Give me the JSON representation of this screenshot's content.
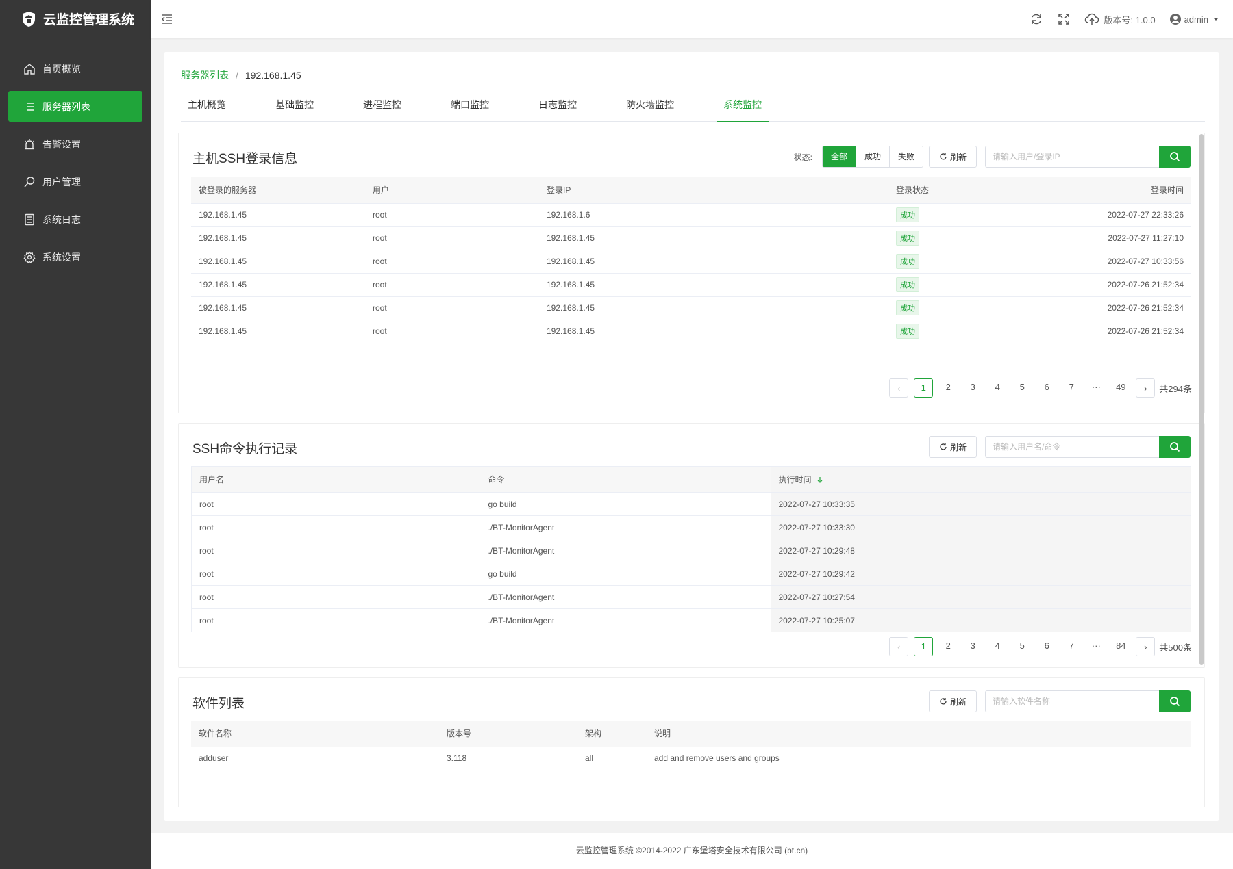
{
  "app": {
    "title": "云监控管理系统"
  },
  "sidebar": {
    "items": [
      {
        "label": "首页概览",
        "icon": "home-icon"
      },
      {
        "label": "服务器列表",
        "icon": "list-icon",
        "active": true
      },
      {
        "label": "告警设置",
        "icon": "alarm-icon"
      },
      {
        "label": "用户管理",
        "icon": "user-search-icon"
      },
      {
        "label": "系统日志",
        "icon": "log-icon"
      },
      {
        "label": "系统设置",
        "icon": "gear-icon"
      }
    ]
  },
  "header": {
    "version_label": "版本号: 1.0.0",
    "user": "admin"
  },
  "breadcrumb": {
    "parent": "服务器列表",
    "separator": "/",
    "current": "192.168.1.45"
  },
  "tabs": [
    "主机概览",
    "基础监控",
    "进程监控",
    "端口监控",
    "日志监控",
    "防火墙监控",
    "系统监控"
  ],
  "active_tab": "系统监控",
  "ssh_login": {
    "title": "主机SSH登录信息",
    "status_label": "状态:",
    "filters": [
      "全部",
      "成功",
      "失败"
    ],
    "refresh": "刷新",
    "search_placeholder": "请输入用户/登录IP",
    "columns": [
      "被登录的服务器",
      "用户",
      "登录IP",
      "登录状态",
      "登录时间"
    ],
    "rows": [
      [
        "192.168.1.45",
        "root",
        "192.168.1.6",
        "成功",
        "2022-07-27 22:33:26"
      ],
      [
        "192.168.1.45",
        "root",
        "192.168.1.45",
        "成功",
        "2022-07-27 11:27:10"
      ],
      [
        "192.168.1.45",
        "root",
        "192.168.1.45",
        "成功",
        "2022-07-27 10:33:56"
      ],
      [
        "192.168.1.45",
        "root",
        "192.168.1.45",
        "成功",
        "2022-07-26 21:52:34"
      ],
      [
        "192.168.1.45",
        "root",
        "192.168.1.45",
        "成功",
        "2022-07-26 21:52:34"
      ],
      [
        "192.168.1.45",
        "root",
        "192.168.1.45",
        "成功",
        "2022-07-26 21:52:34"
      ]
    ],
    "pager": {
      "pages": [
        "1",
        "2",
        "3",
        "4",
        "5",
        "6",
        "7",
        "···",
        "49"
      ],
      "current": "1",
      "total": "共294条"
    }
  },
  "ssh_cmd": {
    "title": "SSH命令执行记录",
    "refresh": "刷新",
    "search_placeholder": "请输入用户名/命令",
    "columns": [
      "用户名",
      "命令",
      "执行时间"
    ],
    "sort_icon": "arrow-down-icon",
    "rows": [
      [
        "root",
        "go build",
        "2022-07-27 10:33:35"
      ],
      [
        "root",
        "./BT-MonitorAgent",
        "2022-07-27 10:33:30"
      ],
      [
        "root",
        "./BT-MonitorAgent",
        "2022-07-27 10:29:48"
      ],
      [
        "root",
        "go build",
        "2022-07-27 10:29:42"
      ],
      [
        "root",
        "./BT-MonitorAgent",
        "2022-07-27 10:27:54"
      ],
      [
        "root",
        "./BT-MonitorAgent",
        "2022-07-27 10:25:07"
      ]
    ],
    "pager": {
      "pages": [
        "1",
        "2",
        "3",
        "4",
        "5",
        "6",
        "7",
        "···",
        "84"
      ],
      "current": "1",
      "total": "共500条"
    }
  },
  "software": {
    "title": "软件列表",
    "refresh": "刷新",
    "search_placeholder": "请输入软件名称",
    "columns": [
      "软件名称",
      "版本号",
      "架构",
      "说明"
    ],
    "rows": [
      [
        "adduser",
        "3.118",
        "all",
        "add and remove users and groups"
      ]
    ]
  },
  "footer": {
    "text": "云监控管理系统 ©2014-2022 广东堡塔安全技术有限公司 (bt.cn)"
  },
  "colors": {
    "accent": "#20a53a",
    "sidebar": "#373737"
  }
}
